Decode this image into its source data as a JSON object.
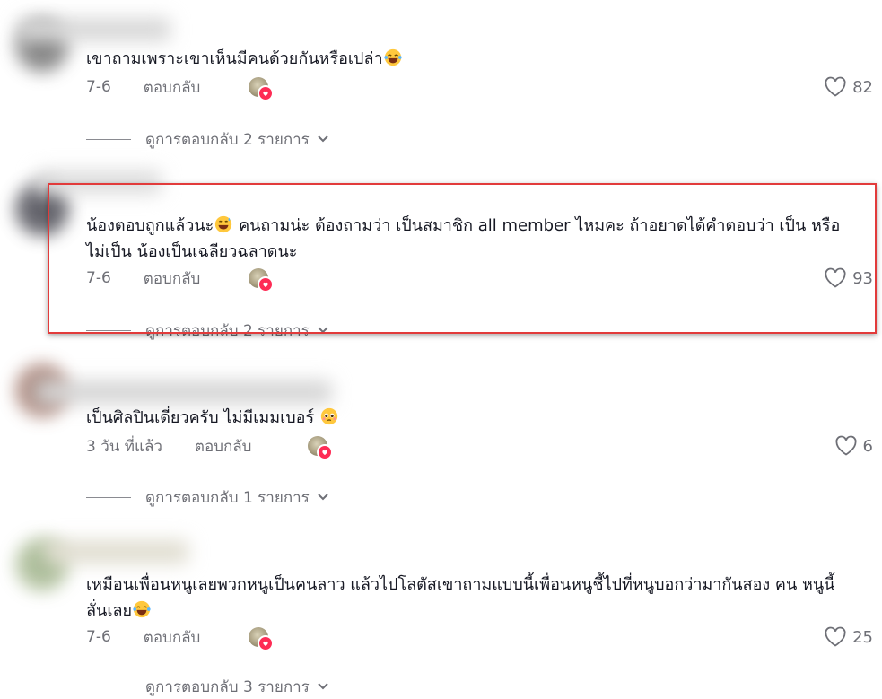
{
  "comments": [
    {
      "text": "เขาถามเพราะเขาเห็นมีคนด้วยกันหรือเปล่า",
      "date": "7-6",
      "reply_label": "ตอบกลับ",
      "likes": "82",
      "view_replies": "ดูการตอบกลับ 2 รายการ"
    },
    {
      "text_part1": "น้องตอบถูกแล้วนะ",
      "text_part2": " คนถามน่ะ ต้องถามว่า เป็นสมาชิก all member ไหมคะ ถ้าอยาดได้คำตอบว่า เป็น หรือ ไม่เป็น น้องเป็นเฉลียวฉลาดนะ",
      "date": "7-6",
      "reply_label": "ตอบกลับ",
      "likes": "93",
      "view_replies": "ดูการตอบกลับ 2 รายการ"
    },
    {
      "text": "เป็นศิลปินเดี่ยวครับ ไม่มีเมมเบอร์",
      "date": "3 วัน ที่แล้ว",
      "reply_label": "ตอบกลับ",
      "likes": "6",
      "view_replies": "ดูการตอบกลับ 1 รายการ"
    },
    {
      "text": "เหมือนเพื่อนหนูเลยพวกหนูเป็นคนลาว แล้วไปโลตัสเขาถามแบบนี้เพื่อนหนูชี้ไปที่หนูบอกว่ามากันสอง คน หนูนี้ลั่นเลย",
      "date": "7-6",
      "reply_label": "ตอบกลับ",
      "likes": "25",
      "view_replies": "ดูการตอบกลับ 3 รายการ"
    }
  ],
  "colors": {
    "text": "#161823",
    "muted": "#6e6f76",
    "heart_badge": "#fe2c55",
    "highlight_border": "#e23b3b"
  },
  "icons": {
    "like": "heart-outline-icon",
    "creator_liked": "creator-liked-badge-icon",
    "expand": "chevron-down-icon",
    "emoji_laugh": "tears-of-joy-emoji",
    "emoji_sweat": "grinning-sweat-emoji",
    "emoji_pleading": "pleading-face-emoji"
  }
}
